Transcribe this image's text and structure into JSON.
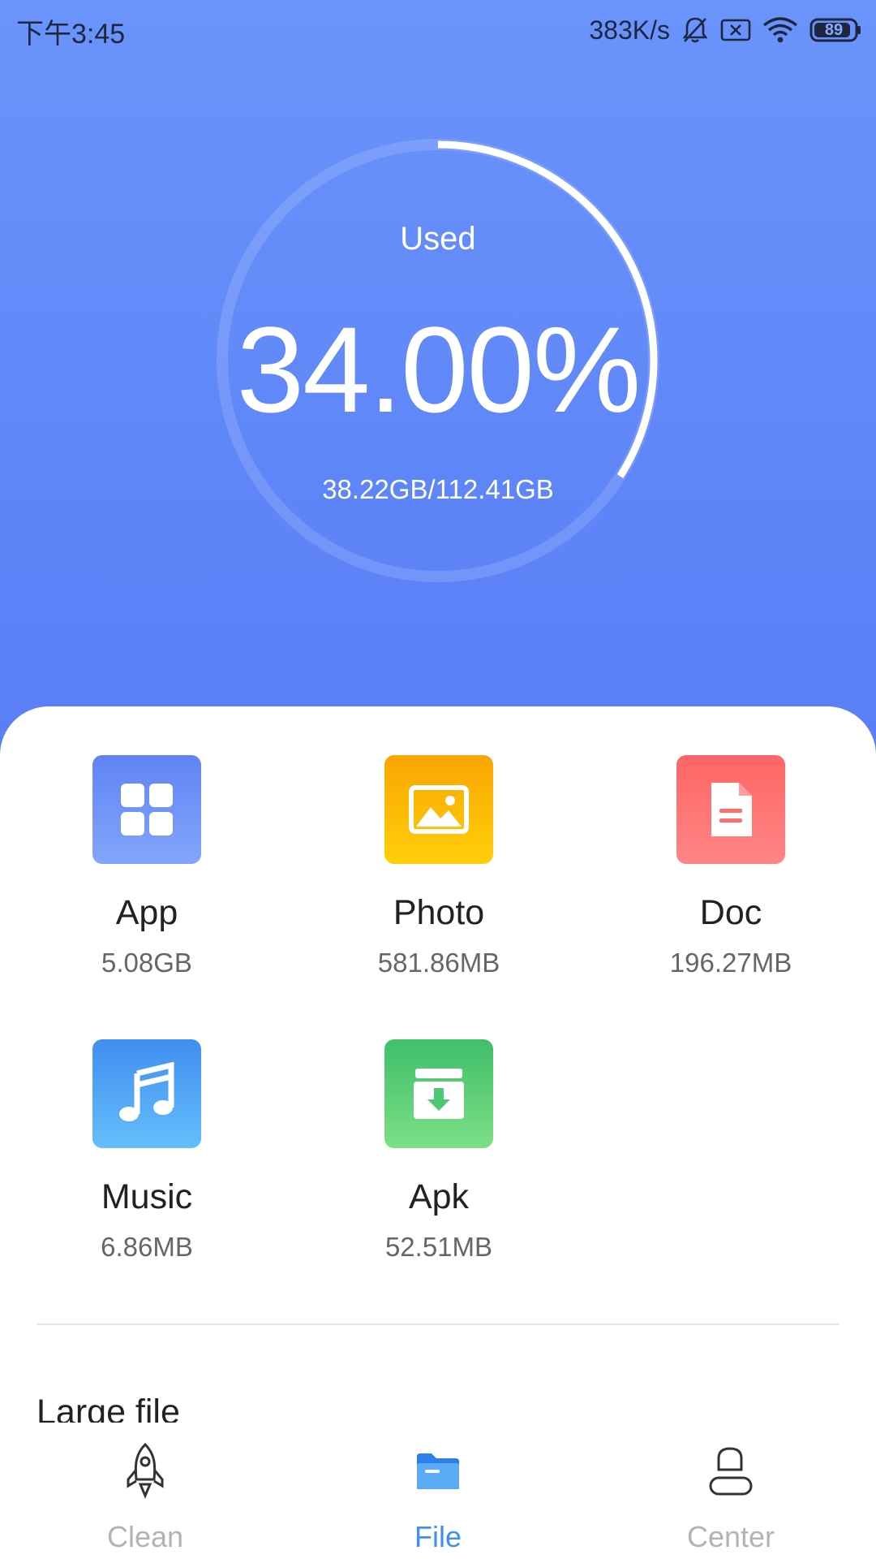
{
  "status_bar": {
    "time": "下午3:45",
    "net_speed": "383K/s",
    "battery": "89"
  },
  "storage": {
    "label": "Used",
    "percent_text": "34.00%",
    "used_fraction": 0.34,
    "detail": "38.22GB/112.41GB"
  },
  "categories": [
    {
      "name": "App",
      "size": "5.08GB",
      "icon": "app-grid-icon",
      "color": "#5f84f3"
    },
    {
      "name": "Photo",
      "size": "581.86MB",
      "icon": "photo-icon",
      "color": "#f9a500"
    },
    {
      "name": "Doc",
      "size": "196.27MB",
      "icon": "document-icon",
      "color": "#ff6565"
    },
    {
      "name": "Music",
      "size": "6.86MB",
      "icon": "music-note-icon",
      "color": "#3f8ff0"
    },
    {
      "name": "Apk",
      "size": "52.51MB",
      "icon": "apk-download-icon",
      "color": "#3fbf6a"
    }
  ],
  "large_file": {
    "title": "Large file"
  },
  "bottom_nav": {
    "items": [
      {
        "label": "Clean",
        "icon": "rocket-icon",
        "active": false
      },
      {
        "label": "File",
        "icon": "folder-icon",
        "active": true
      },
      {
        "label": "Center",
        "icon": "user-icon",
        "active": false
      }
    ]
  },
  "colors": {
    "header_gradient_top": "#6a94fb",
    "header_gradient_bottom": "#4e6bf2",
    "active_nav": "#3f8ff0",
    "inactive_nav": "#b3b3b3"
  }
}
